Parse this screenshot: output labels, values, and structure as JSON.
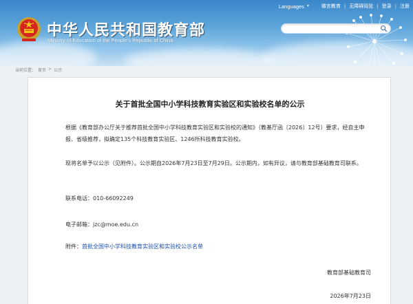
{
  "topbar": {
    "language": "Languages",
    "links": [
      "微言教育",
      "无障碍阅览",
      "登录",
      "注册"
    ]
  },
  "header": {
    "title": "中华人民共和国教育部",
    "subtitle": "Ministry of Education of the People's Republic of China"
  },
  "search": {
    "placeholder": ""
  },
  "breadcrumb": {
    "label": "当前位置：",
    "home": "首页",
    "current": "公示"
  },
  "article": {
    "title": "关于首批全国中小学科技教育实验区和实验校名单的公示",
    "para1": "根据《教育部办公厅关于推荐首批全国中小学科技教育实验区和实验校的通知》（教基厅函〔2026〕12号）要求，经自主申报、省级推荐，拟确定135个科技教育实验区、1246所科技教育实验校。",
    "para2": "现将名单予以公示（见附件）。公示期自2026年7月23日至7月29日。公示期内，如有异议，请与教育部基础教育司联系。",
    "phone": "联系电话：010-66092249",
    "email": "电子邮箱：jzc@moe.edu.cn",
    "attachment_label": "附件：",
    "attachment_link": "首批全国中小学科技教育实验区和实验校公示名单",
    "signature": "教育部基础教育司",
    "date": "2026年7月23日"
  }
}
